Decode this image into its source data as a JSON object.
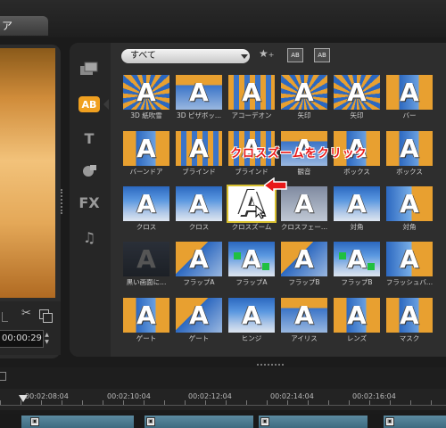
{
  "window": {
    "tab_label": "ア"
  },
  "preview": {
    "timecode": "00:00:29"
  },
  "library": {
    "filter": {
      "selected": "すべて"
    },
    "categories": [
      {
        "name": "media-icon"
      },
      {
        "name": "transition-icon",
        "label": "AB"
      },
      {
        "name": "title-icon",
        "label": "T"
      },
      {
        "name": "graphics-icon"
      },
      {
        "name": "filter-icon",
        "label": "FX"
      },
      {
        "name": "audio-icon",
        "label": "♫"
      }
    ],
    "thumbnails": [
      [
        "3D 紙吹雪",
        "3D ピザボッ...",
        "アコーデオン",
        "矢印",
        "矢印",
        "バー"
      ],
      [
        "バーンドア",
        "ブラインド",
        "ブラインド",
        "観音",
        "ボックス",
        "ボックス"
      ],
      [
        "クロス",
        "クロス",
        "クロスズーム",
        "クロスフェー...",
        "対角",
        "対角"
      ],
      [
        "黒い画面に...",
        "フラップA",
        "フラップA",
        "フラップB",
        "フラップB",
        "フラッシュバ..."
      ],
      [
        "ゲート",
        "ゲート",
        "ヒンジ",
        "アイリス",
        "レンズ",
        "マスク"
      ]
    ],
    "thumbnail_glyph": "A",
    "selected": "クロスズーム",
    "instruction": "クロスズームをクリック"
  },
  "timeline": {
    "ruler": [
      "00:02:08:04",
      "00:02:10:04",
      "00:02:12:04",
      "00:02:14:04",
      "00:02:16:04"
    ]
  }
}
